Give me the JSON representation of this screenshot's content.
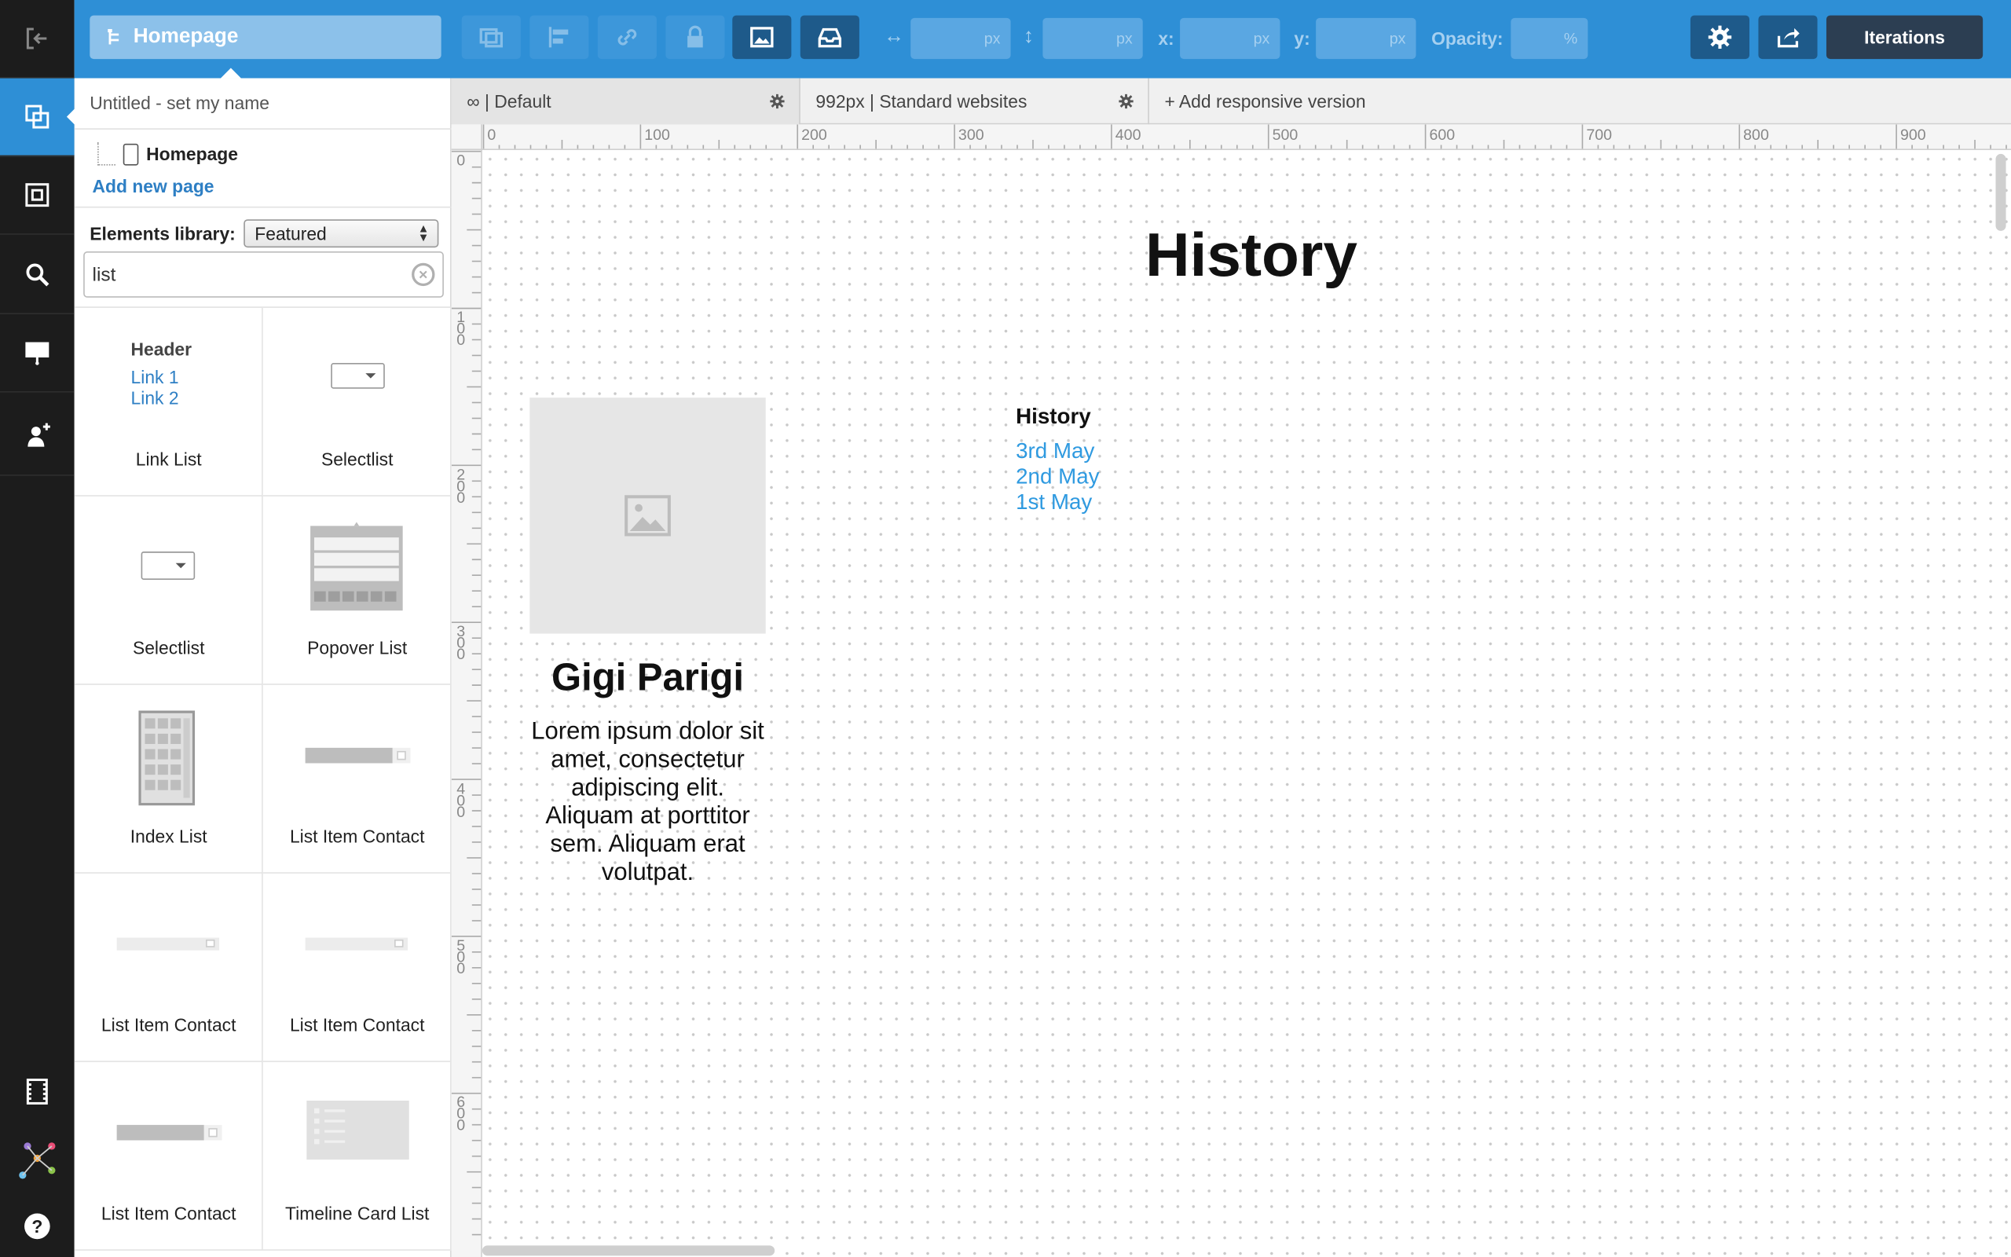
{
  "topbar": {
    "page_button": "Homepage",
    "width_label": "↔",
    "height_label": "↕",
    "x_label": "x:",
    "y_label": "y:",
    "opacity_label": "Opacity:",
    "unit_px": "px",
    "unit_pct": "%",
    "iterations": "Iterations"
  },
  "panel": {
    "project_name": "Untitled - set my name",
    "page_tree_item": "Homepage",
    "add_new_page": "Add new page",
    "library_label": "Elements library:",
    "library_value": "Featured",
    "search_value": "list",
    "items": [
      {
        "label": "Link List",
        "thumb_header": "Header",
        "thumb_link1": "Link 1",
        "thumb_link2": "Link 2"
      },
      {
        "label": "Selectlist"
      },
      {
        "label": "Selectlist"
      },
      {
        "label": "Popover List"
      },
      {
        "label": "Index List"
      },
      {
        "label": "List Item Contact"
      },
      {
        "label": "List Item Contact"
      },
      {
        "label": "List Item Contact"
      },
      {
        "label": "List Item Contact"
      },
      {
        "label": "Timeline Card List"
      }
    ]
  },
  "tabs": [
    {
      "label": "∞ |  Default"
    },
    {
      "label": "992px |  Standard websites"
    },
    {
      "label": "+ Add responsive version"
    }
  ],
  "ruler": {
    "top": [
      "0",
      "100",
      "200",
      "300",
      "400",
      "500",
      "600",
      "700",
      "800",
      "900"
    ],
    "left": [
      "0",
      "100",
      "200",
      "300",
      "400",
      "500",
      "600"
    ]
  },
  "canvas": {
    "title": "History",
    "name": "Gigi Parigi",
    "body": "Lorem ipsum dolor sit amet, consectetur adipiscing elit. Aliquam at porttitor sem. Aliquam erat volutpat.",
    "history_heading": "History",
    "history_links": [
      "3rd May",
      "2nd May",
      "1st May"
    ]
  },
  "colors": {
    "accent": "#2e8fd6",
    "rail": "#1c1c1c",
    "link": "#2f9ae0"
  }
}
